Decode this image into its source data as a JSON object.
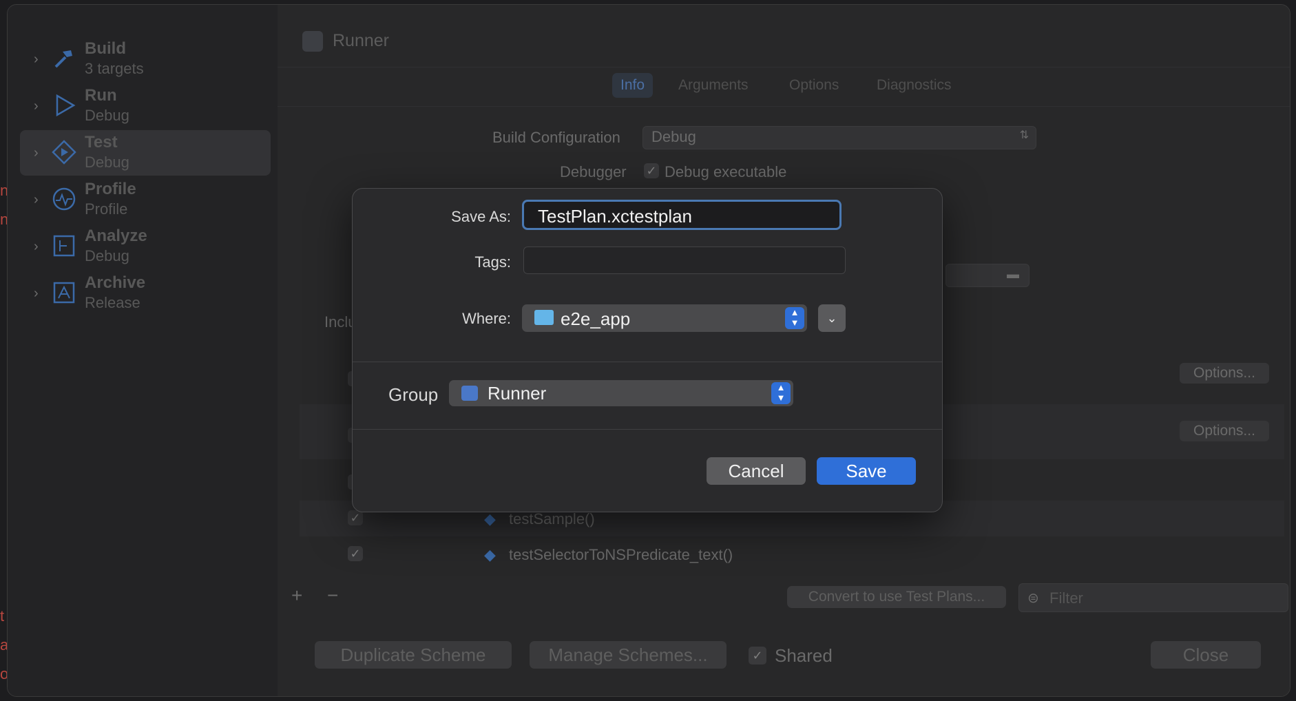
{
  "sidebar": {
    "items": [
      {
        "title": "Build",
        "subtitle": "3 targets",
        "icon": "hammer-icon"
      },
      {
        "title": "Run",
        "subtitle": "Debug",
        "icon": "play-icon"
      },
      {
        "title": "Test",
        "subtitle": "Debug",
        "icon": "test-diamond-icon",
        "selected": true
      },
      {
        "title": "Profile",
        "subtitle": "Profile",
        "icon": "gauge-icon"
      },
      {
        "title": "Analyze",
        "subtitle": "Debug",
        "icon": "analyze-icon"
      },
      {
        "title": "Archive",
        "subtitle": "Release",
        "icon": "archive-icon"
      }
    ]
  },
  "scheme": {
    "title": "Runner",
    "tabs": [
      "Info",
      "Arguments",
      "Options",
      "Diagnostics"
    ],
    "active_tab": "Info",
    "build_configuration_label": "Build Configuration",
    "build_configuration_value": "Debug",
    "debugger_label": "Debugger",
    "debug_executable_label": "Debug executable",
    "includes_label": "Inclu",
    "options_button": "Options...",
    "test_rows": [
      "testSample()",
      "testSelectorToNSPredicate_text()"
    ],
    "convert_button": "Convert to use Test Plans...",
    "filter_placeholder": "Filter",
    "duplicate_button": "Duplicate Scheme",
    "manage_button": "Manage Schemes...",
    "shared_label": "Shared",
    "close_button": "Close"
  },
  "dialog": {
    "save_as_label": "Save As:",
    "save_as_value": "TestPlan.xctestplan",
    "tags_label": "Tags:",
    "where_label": "Where:",
    "where_value": "e2e_app",
    "group_label": "Group",
    "group_value": "Runner",
    "cancel_label": "Cancel",
    "save_label": "Save"
  },
  "colors": {
    "accent": "#2f6fd8",
    "focus_ring": "#4a79b3",
    "folder": "#64b5e8"
  }
}
